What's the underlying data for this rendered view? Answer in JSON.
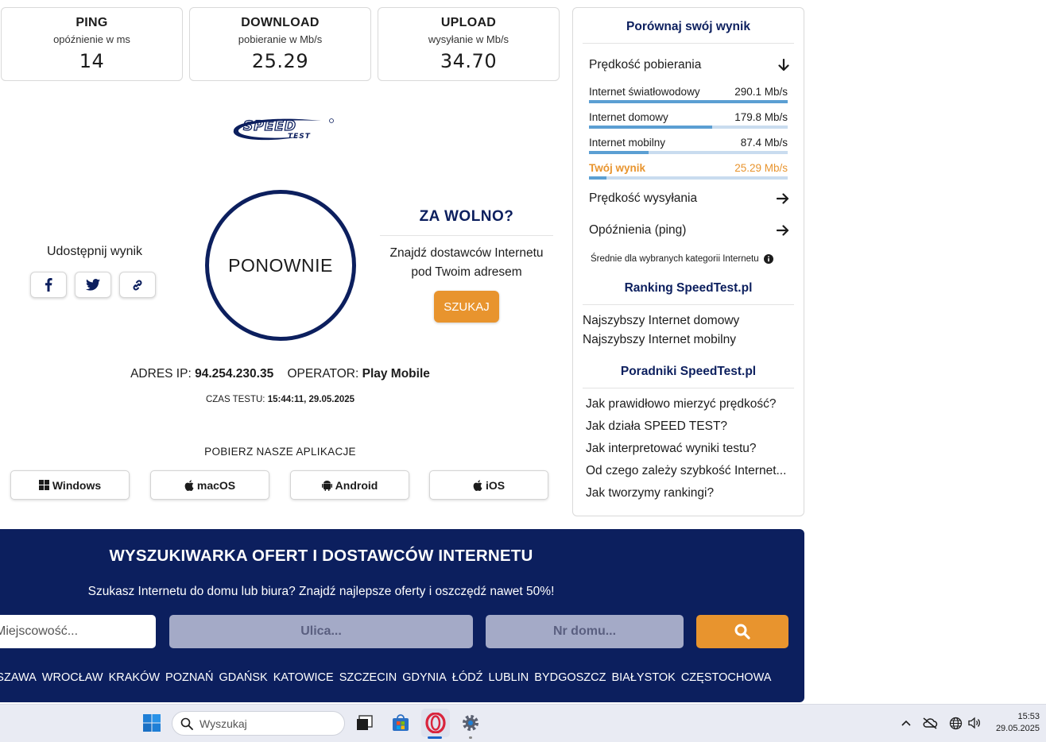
{
  "stats": {
    "ping": {
      "title": "PING",
      "sub": "opóźnienie w ms",
      "value": "14"
    },
    "download": {
      "title": "DOWNLOAD",
      "sub": "pobieranie w Mb/s",
      "value": "25.29"
    },
    "upload": {
      "title": "UPLOAD",
      "sub": "wysyłanie w Mb/s",
      "value": "34.70"
    }
  },
  "main": {
    "restart_label": "PONOWNIE",
    "share_label": "Udostępnij wynik",
    "ip_label": "ADRES IP:",
    "ip_value": "94.254.230.35",
    "operator_label": "OPERATOR:",
    "operator_value": "Play Mobile",
    "time_label": "CZAS TESTU:",
    "time_value": "15:44:11, 29.05.2025",
    "apps_title": "POBIERZ NASZE APLIKACJE",
    "apps": [
      "Windows",
      "macOS",
      "Android",
      "iOS"
    ]
  },
  "promo": {
    "title": "ZA WOLNO?",
    "line1": "Znajdź dostawców Internetu",
    "line2": "pod Twoim adresem",
    "button": "SZUKAJ"
  },
  "sidebar": {
    "compare_title": "Porównaj swój wynik",
    "download_speed": "Prędkość pobierania",
    "bars": [
      {
        "label": "Internet światłowodowy",
        "value": "290.1 Mb/s",
        "fraction": 1.0
      },
      {
        "label": "Internet domowy",
        "value": "179.8 Mb/s",
        "fraction": 0.62
      },
      {
        "label": "Internet mobilny",
        "value": "87.4 Mb/s",
        "fraction": 0.3
      },
      {
        "label": "Twój wynik",
        "value": "25.29 Mb/s",
        "fraction": 0.087
      }
    ],
    "upload_speed": "Prędkość wysyłania",
    "latency": "Opóźnienia (ping)",
    "note": "Średnie dla wybranych kategorii Internetu",
    "ranking_title": "Ranking SpeedTest.pl",
    "ranking_links": [
      "Najszybszy Internet domowy",
      "Najszybszy Internet mobilny"
    ],
    "guides_title": "Poradniki SpeedTest.pl",
    "guides_links": [
      "Jak prawidłowo mierzyć prędkość?",
      "Jak działa SPEED TEST?",
      "Jak interpretować wyniki testu?",
      "Od czego zależy szybkość Internet...",
      "Jak tworzymy rankingi?"
    ]
  },
  "search_section": {
    "title": "WYSZUKIWARKA OFERT I DOSTAWCÓW INTERNETU",
    "subtitle": "Szukasz Internetu do domu lub biura? Znajdź najlepsze oferty i oszczędź nawet 50%!",
    "city_placeholder": "Miejscowość...",
    "street_placeholder": "Ulica...",
    "house_placeholder": "Nr domu...",
    "cities": [
      "WARSZAWA",
      "WROCŁAW",
      "KRAKÓW",
      "POZNAŃ",
      "GDAŃSK",
      "KATOWICE",
      "SZCZECIN",
      "GDYNIA",
      "ŁÓDŹ",
      "LUBLIN",
      "BYDGOSZCZ",
      "BIAŁYSTOK",
      "CZĘSTOCHOWA"
    ]
  },
  "taskbar": {
    "search_placeholder": "Wyszukaj",
    "time": "15:53",
    "date": "29.05.2025"
  },
  "colors": {
    "navy": "#0c1f5e",
    "orange": "#e8942e",
    "bar_blue": "#5b9fd3",
    "your_result": "#e8942e"
  }
}
